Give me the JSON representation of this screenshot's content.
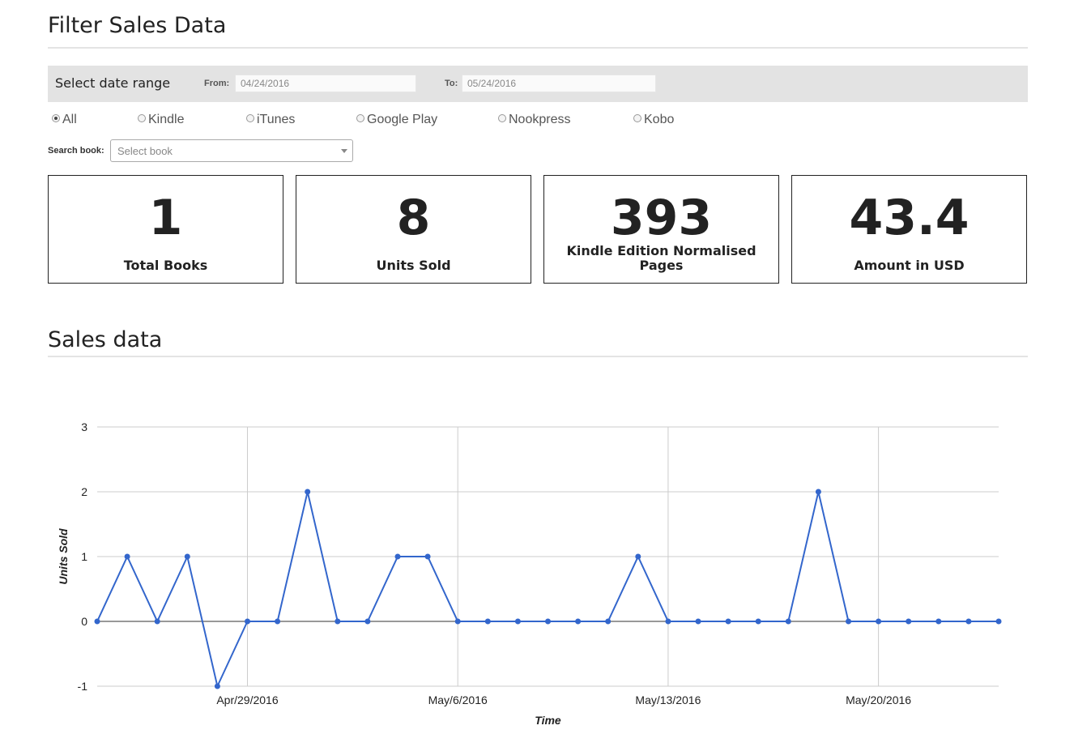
{
  "header": {
    "title": "Filter Sales Data"
  },
  "date_range": {
    "title": "Select date range",
    "from_label": "From:",
    "from_value": "04/24/2016",
    "to_label": "To:",
    "to_value": "05/24/2016"
  },
  "stores": {
    "options": [
      "All",
      "Kindle",
      "iTunes",
      "Google Play",
      "Nookpress",
      "Kobo"
    ],
    "selected": "All"
  },
  "search": {
    "label": "Search book:",
    "placeholder": "Select book"
  },
  "stats": [
    {
      "value": "1",
      "label": "Total Books"
    },
    {
      "value": "8",
      "label": "Units Sold"
    },
    {
      "value": "393",
      "label": "Kindle Edition Normalised Pages"
    },
    {
      "value": "43.4",
      "label": "Amount in USD"
    }
  ],
  "sales": {
    "title": "Sales data"
  },
  "colors": {
    "line": "#3366cc",
    "grid": "#cccccc",
    "zero_line": "#333333",
    "panel": "#e3e3e3"
  },
  "chart_data": {
    "type": "line",
    "xlabel": "Time",
    "ylabel": "Units Sold",
    "ylim": [
      -1,
      3
    ],
    "yticks": [
      3,
      2,
      1,
      0,
      -1
    ],
    "x_start": "2016-04-24",
    "x_end": "2016-05-24",
    "xticks": [
      "Apr/29/2016",
      "May/6/2016",
      "May/13/2016",
      "May/20/2016"
    ],
    "grid": true,
    "legend": "none",
    "series": [
      {
        "values": [
          0,
          1,
          0,
          1,
          -1,
          0,
          0,
          2,
          0,
          0,
          1,
          1,
          0,
          0,
          0,
          0,
          0,
          0,
          1,
          0,
          0,
          0,
          0,
          0,
          2,
          0,
          0,
          0,
          0,
          0,
          0
        ]
      }
    ]
  }
}
